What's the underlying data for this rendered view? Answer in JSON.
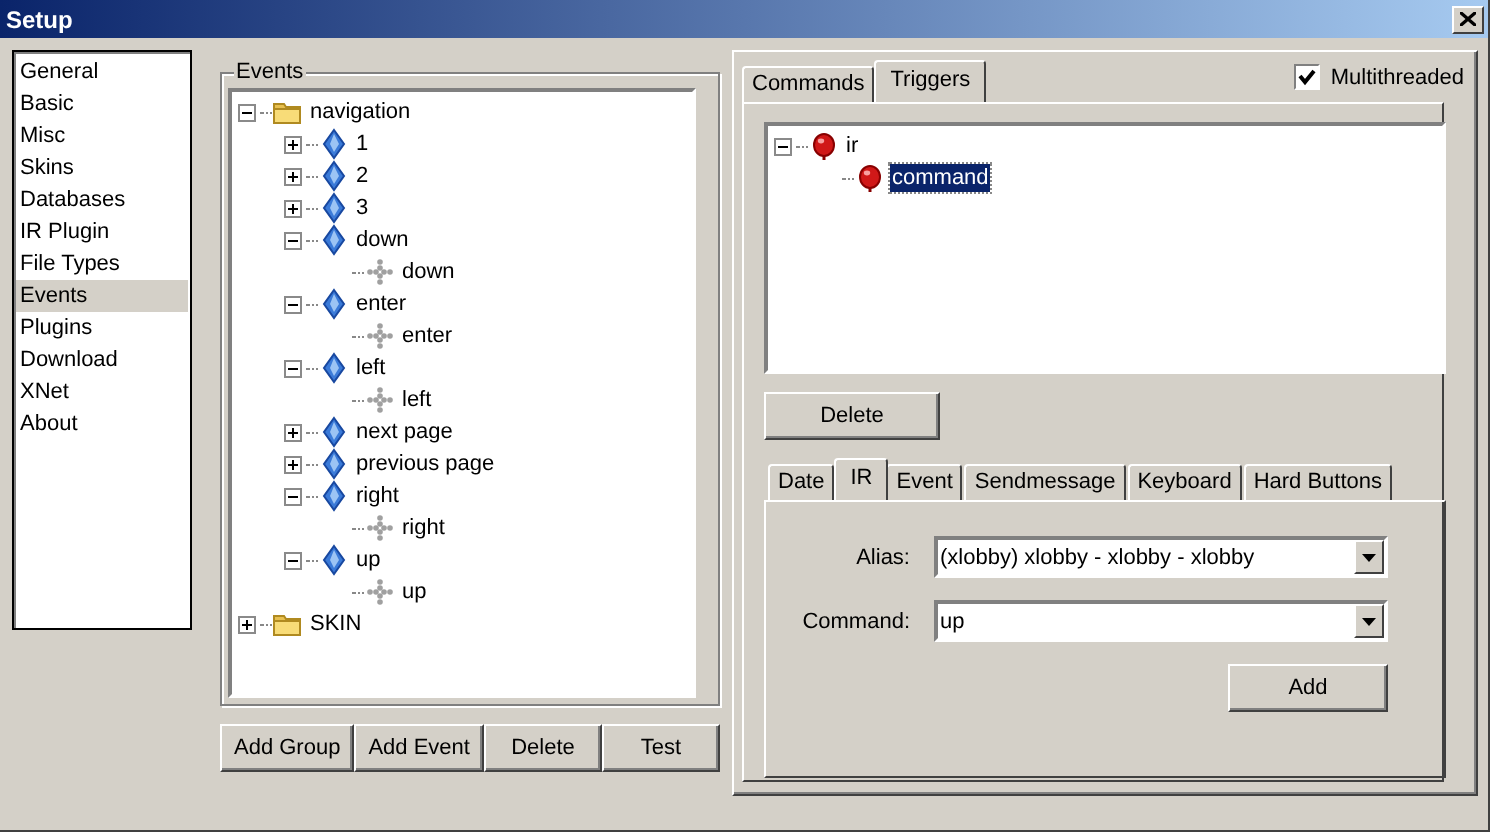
{
  "window": {
    "title": "Setup"
  },
  "sidebar": {
    "items": [
      {
        "label": "General",
        "selected": false
      },
      {
        "label": "Basic",
        "selected": false
      },
      {
        "label": "Misc",
        "selected": false
      },
      {
        "label": "Skins",
        "selected": false
      },
      {
        "label": "Databases",
        "selected": false
      },
      {
        "label": "IR Plugin",
        "selected": false
      },
      {
        "label": "File Types",
        "selected": false
      },
      {
        "label": "Events",
        "selected": true
      },
      {
        "label": "Plugins",
        "selected": false
      },
      {
        "label": "Download",
        "selected": false
      },
      {
        "label": "XNet",
        "selected": false
      },
      {
        "label": "About",
        "selected": false
      }
    ]
  },
  "events": {
    "title": "Events",
    "tree": [
      {
        "label": "navigation",
        "kind": "folder",
        "expanded": true,
        "children": [
          {
            "label": "1",
            "kind": "event",
            "expanded": false
          },
          {
            "label": "2",
            "kind": "event",
            "expanded": false
          },
          {
            "label": "3",
            "kind": "event",
            "expanded": false
          },
          {
            "label": "down",
            "kind": "event",
            "expanded": true,
            "children": [
              {
                "label": "down",
                "kind": "action"
              }
            ]
          },
          {
            "label": "enter",
            "kind": "event",
            "expanded": true,
            "children": [
              {
                "label": "enter",
                "kind": "action"
              }
            ]
          },
          {
            "label": "left",
            "kind": "event",
            "expanded": true,
            "children": [
              {
                "label": "left",
                "kind": "action"
              }
            ]
          },
          {
            "label": "next page",
            "kind": "event",
            "expanded": false
          },
          {
            "label": "previous page",
            "kind": "event",
            "expanded": false
          },
          {
            "label": "right",
            "kind": "event",
            "expanded": true,
            "children": [
              {
                "label": "right",
                "kind": "action"
              }
            ]
          },
          {
            "label": "up",
            "kind": "event",
            "expanded": true,
            "children": [
              {
                "label": "up",
                "kind": "action"
              }
            ]
          }
        ]
      },
      {
        "label": "SKIN",
        "kind": "folder",
        "expanded": false
      }
    ],
    "buttons": [
      "Add Group",
      "Add Event",
      "Delete",
      "Test"
    ]
  },
  "tabs": [
    {
      "label": "Commands",
      "selected": false
    },
    {
      "label": "Triggers",
      "selected": true
    }
  ],
  "multithreaded": {
    "label": "Multithreaded",
    "checked": true
  },
  "triggers": {
    "tree": [
      {
        "label": "ir",
        "kind": "trigger",
        "expanded": true,
        "selected": false,
        "children": [
          {
            "label": "command",
            "kind": "trigger",
            "selected": true
          }
        ]
      }
    ],
    "delete_button": "Delete"
  },
  "trigger_tabs": [
    {
      "label": "Date",
      "selected": false
    },
    {
      "label": "IR",
      "selected": true
    },
    {
      "label": "Event",
      "selected": false
    },
    {
      "label": "Sendmessage",
      "selected": false
    },
    {
      "label": "Keyboard",
      "selected": false
    },
    {
      "label": "Hard Buttons",
      "selected": false
    }
  ],
  "ir": {
    "alias": {
      "label": "Alias:",
      "value": "(xlobby) xlobby - xlobby - xlobby"
    },
    "command": {
      "label": "Command:",
      "value": "up"
    },
    "add_button": "Add"
  }
}
